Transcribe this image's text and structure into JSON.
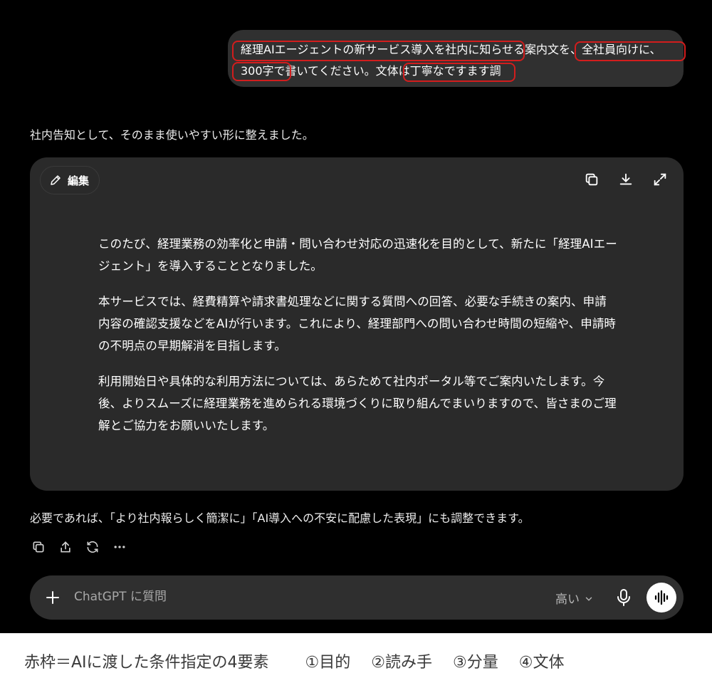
{
  "user_message": {
    "line1": "経理AIエージェントの新サービス導入を社内に知らせる案内文を、全社員向けに、",
    "line2": "300字で書いてください。文体は丁寧なですます調"
  },
  "assistant": {
    "intro": "社内告知として、そのまま使いやすい形に整えました。",
    "edit_label": "編集",
    "document_paragraphs": [
      "このたび、経理業務の効率化と申請・問い合わせ対応の迅速化を目的として、新たに「経理AIエージェント」を導入することとなりました。",
      "本サービスでは、経費精算や請求書処理などに関する質問への回答、必要な手続きの案内、申請内容の確認支援などをAIが行います。これにより、経理部門への問い合わせ時間の短縮や、申請時の不明点の早期解消を目指します。",
      "利用開始日や具体的な利用方法については、あらためて社内ポータル等でご案内いたします。今後、よりスムーズに経理業務を進められる環境づくりに取り組んでまいりますので、皆さまのご理解とご協力をお願いいたします。"
    ],
    "followup": "必要であれば、「より社内報らしく簡潔に」「AI導入への不安に配慮した表現」にも調整できます。"
  },
  "composer": {
    "placeholder": "ChatGPT に質問",
    "model_label": "高い"
  },
  "caption": {
    "main": "赤枠＝AIに渡した条件指定の4要素",
    "items": [
      "①目的",
      "②読み手",
      "③分量",
      "④文体"
    ]
  },
  "colors": {
    "background": "#000000",
    "bubble": "#303030",
    "card": "#2a2a2a",
    "highlight_red": "#d21d1d"
  },
  "icons": [
    "pencil-icon",
    "copy-icon",
    "download-icon",
    "expand-icon",
    "share-icon",
    "regenerate-icon",
    "more-icon",
    "plus-icon",
    "chevron-down-icon",
    "mic-icon",
    "voice-waveform-icon"
  ]
}
